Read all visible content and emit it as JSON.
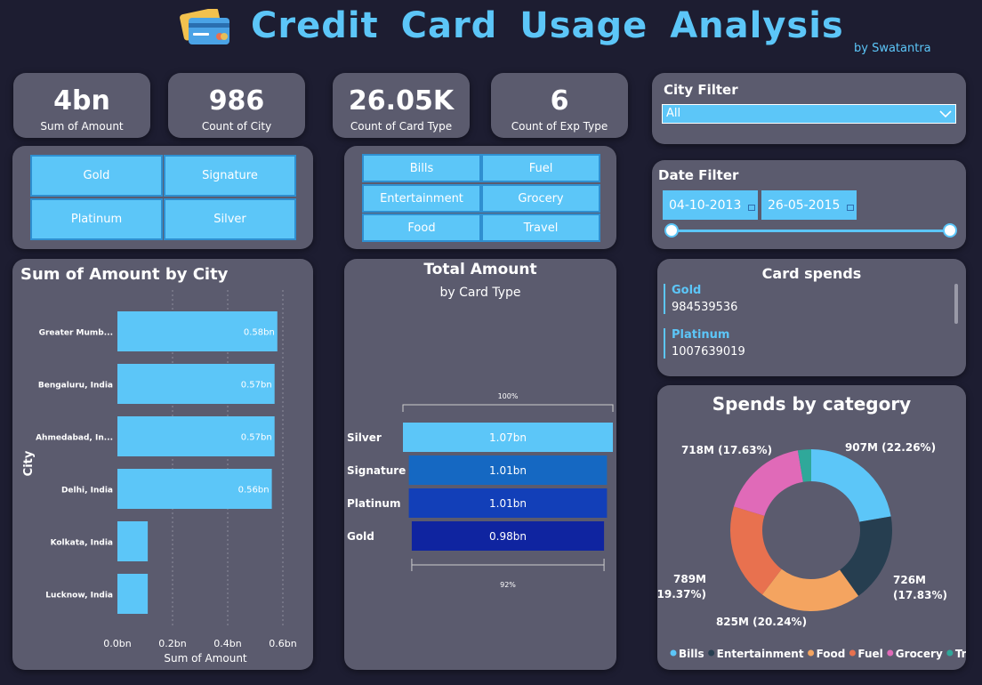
{
  "header": {
    "title": "Credit Card Usage Analysis",
    "byline": "by Swatantra"
  },
  "kpis": [
    {
      "value": "4bn",
      "label": "Sum of Amount"
    },
    {
      "value": "986",
      "label": "Count of City"
    },
    {
      "value": "26.05K",
      "label": "Count of Card Type"
    },
    {
      "value": "6",
      "label": "Count of Exp Type"
    }
  ],
  "card_type_slicer": [
    "Gold",
    "Signature",
    "Platinum",
    "Silver"
  ],
  "exp_type_slicer": [
    "Bills",
    "Fuel",
    "Entertainment",
    "Grocery",
    "Food",
    "Travel"
  ],
  "city_filter": {
    "title": "City Filter",
    "value": "All"
  },
  "date_filter": {
    "title": "Date Filter",
    "start": "04-10-2013",
    "end": "26-05-2015"
  },
  "card_spends": {
    "title": "Card spends",
    "items": [
      {
        "category": "Gold",
        "amount": "984539536"
      },
      {
        "category": "Platinum",
        "amount": "1007639019"
      }
    ]
  },
  "colors": {
    "background": "#1d1d31",
    "card": "#5b5b6e",
    "accent": "#5cc6f8",
    "funnel": [
      "#5cc6f8",
      "#1568c2",
      "#123fb8",
      "#0f24a0"
    ],
    "donut": [
      "#5cc6f8",
      "#263e50",
      "#f4a460",
      "#e8714f",
      "#e06ab8",
      "#2fa89a"
    ]
  },
  "chart_data": [
    {
      "type": "bar",
      "orientation": "horizontal",
      "title": "Sum of Amount by City",
      "xlabel": "Sum of Amount",
      "ylabel": "City",
      "categories": [
        "Greater Mumb...",
        "Bengaluru, India",
        "Ahmedabad, In...",
        "Delhi, India",
        "Kolkata, India",
        "Lucknow, India"
      ],
      "values": [
        0.58,
        0.57,
        0.57,
        0.56,
        0.11,
        0.11
      ],
      "data_labels": [
        "0.58bn",
        "0.57bn",
        "0.57bn",
        "0.56bn",
        "",
        ""
      ],
      "unit": "bn",
      "xticks": [
        "0.0bn",
        "0.2bn",
        "0.4bn",
        "0.6bn"
      ],
      "xlim": [
        0,
        0.6
      ],
      "grid": true
    },
    {
      "type": "bar",
      "subtype": "funnel",
      "title": "Total Amount",
      "subtitle": "by Card Type",
      "categories": [
        "Silver",
        "Signature",
        "Platinum",
        "Gold"
      ],
      "values": [
        1.07,
        1.01,
        1.01,
        0.98
      ],
      "data_labels": [
        "1.07bn",
        "1.01bn",
        "1.01bn",
        "0.98bn"
      ],
      "top_percent": "100%",
      "bottom_percent": "92%"
    },
    {
      "type": "pie",
      "subtype": "donut",
      "title": "Spends by category",
      "categories": [
        "Bills",
        "Entertainment",
        "Food",
        "Fuel",
        "Grocery",
        "Travel"
      ],
      "values": [
        907,
        726,
        825,
        789,
        718,
        108
      ],
      "data_labels": [
        "907M (22.26%)",
        "726M (17.83%)",
        "825M (20.24%)",
        "789M (19.37%)",
        "718M (17.63%)",
        ""
      ],
      "legend_position": "bottom"
    }
  ]
}
